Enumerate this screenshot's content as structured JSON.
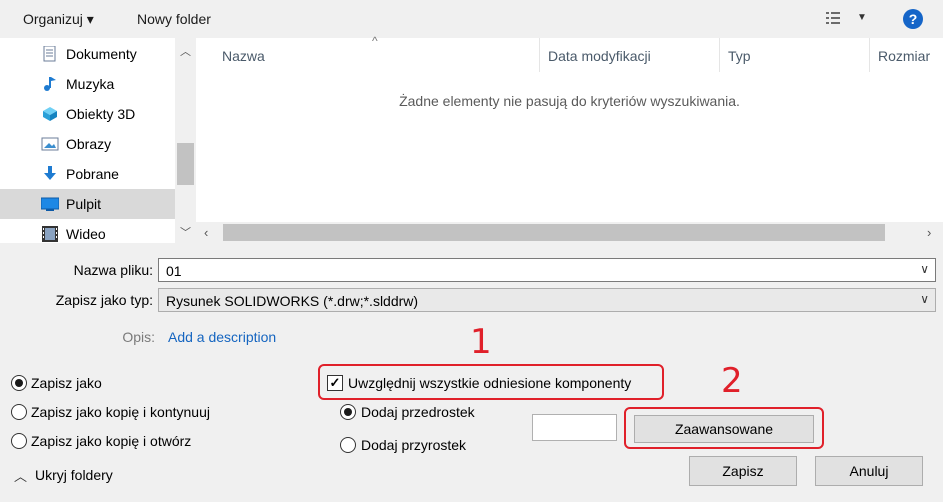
{
  "toolbar": {
    "organize_label": "Organizuj ▾",
    "new_folder_label": "Nowy folder",
    "help_label": "?"
  },
  "nav": {
    "items": [
      {
        "label": "Dokumenty",
        "icon": "documents-icon"
      },
      {
        "label": "Muzyka",
        "icon": "music-icon"
      },
      {
        "label": "Obiekty 3D",
        "icon": "3d-objects-icon"
      },
      {
        "label": "Obrazy",
        "icon": "pictures-icon"
      },
      {
        "label": "Pobrane",
        "icon": "downloads-icon"
      },
      {
        "label": "Pulpit",
        "icon": "desktop-icon",
        "selected": true
      },
      {
        "label": "Wideo",
        "icon": "video-icon"
      }
    ]
  },
  "file_list": {
    "columns": [
      "Nazwa",
      "Data modyfikacji",
      "Typ",
      "Rozmiar"
    ],
    "empty_message": "Żadne elementy nie pasują do kryteriów wyszukiwania."
  },
  "form": {
    "filename_label": "Nazwa pliku:",
    "filename_value": "01",
    "savetype_label": "Zapisz jako typ:",
    "savetype_value": "Rysunek SOLIDWORKS (*.drw;*.slddrw)",
    "desc_label": "Opis:",
    "desc_link": "Add a description"
  },
  "options": {
    "save_modes": [
      {
        "label": "Zapisz jako",
        "checked": true
      },
      {
        "label": "Zapisz jako kopię i kontynuuj",
        "checked": false
      },
      {
        "label": "Zapisz jako kopię i otwórz",
        "checked": false
      }
    ],
    "include_refs_label": "Uwzględnij wszystkie odniesione komponenty",
    "include_refs_checked": true,
    "affix": [
      {
        "label": "Dodaj przedrostek",
        "checked": true
      },
      {
        "label": "Dodaj przyrostek",
        "checked": false
      }
    ],
    "affix_value": "",
    "advanced_label": "Zaawansowane"
  },
  "footer": {
    "hide_folders_label": "Ukryj foldery",
    "save_label": "Zapisz",
    "cancel_label": "Anuluj"
  },
  "annotations": {
    "callout_1": "1",
    "callout_2": "2",
    "color": "#e0202a"
  }
}
